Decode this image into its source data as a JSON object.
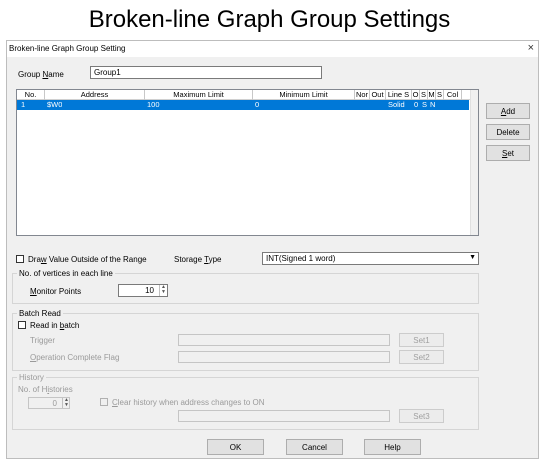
{
  "page_title": "Broken-line Graph Group Settings",
  "dialog": {
    "title": "Broken-line Graph Group Setting",
    "close_glyph": "×"
  },
  "group_name": {
    "label_pre": "Group ",
    "label_key": "N",
    "label_post": "ame",
    "value": "Group1"
  },
  "grid": {
    "columns": [
      "No.",
      "Address",
      "Maximum Limit",
      "Minimum Limit",
      "Nor",
      "Out",
      "Line S",
      "O",
      "S",
      "M",
      "S",
      "Col"
    ],
    "rows": [
      {
        "no": "1",
        "address": "$W0",
        "max": "100",
        "min": "0",
        "nor": "",
        "out": "",
        "line": "Solid",
        "o": "0",
        "s": "S",
        "m": "N",
        "s2": "",
        "col": ""
      }
    ]
  },
  "side_buttons": {
    "add": "Add",
    "add_key": "A",
    "delete": "Delete",
    "set": "Set",
    "set_key": "S"
  },
  "draw_outside": {
    "pre": "Dra",
    "key": "w",
    "post": " Value Outside of the Range"
  },
  "storage_type": {
    "pre": "Storage ",
    "key": "T",
    "post": "ype",
    "value": "INT(Signed 1 word)"
  },
  "vertices": {
    "group_title": "No. of vertices in each line",
    "monitor_key": "M",
    "monitor_post": "onitor Points",
    "monitor_value": "10"
  },
  "batch": {
    "group_title": "Batch Read",
    "read_pre": "Read in ",
    "read_key": "b",
    "read_post": "atch",
    "trigger": "Trigger",
    "operation_key": "O",
    "operation_post": "peration Complete Flag",
    "set1": "Set1",
    "set2": "Set2"
  },
  "history": {
    "group_title": "History",
    "histories_pre": "No. of H",
    "histories_key": "i",
    "histories_post": "stories",
    "histories_value": "0",
    "clear_pre": "",
    "clear_key": "C",
    "clear_post": "lear history when address changes to ON",
    "set3": "Set3"
  },
  "bottom_buttons": {
    "ok": "OK",
    "cancel": "Cancel",
    "help": "Help"
  }
}
